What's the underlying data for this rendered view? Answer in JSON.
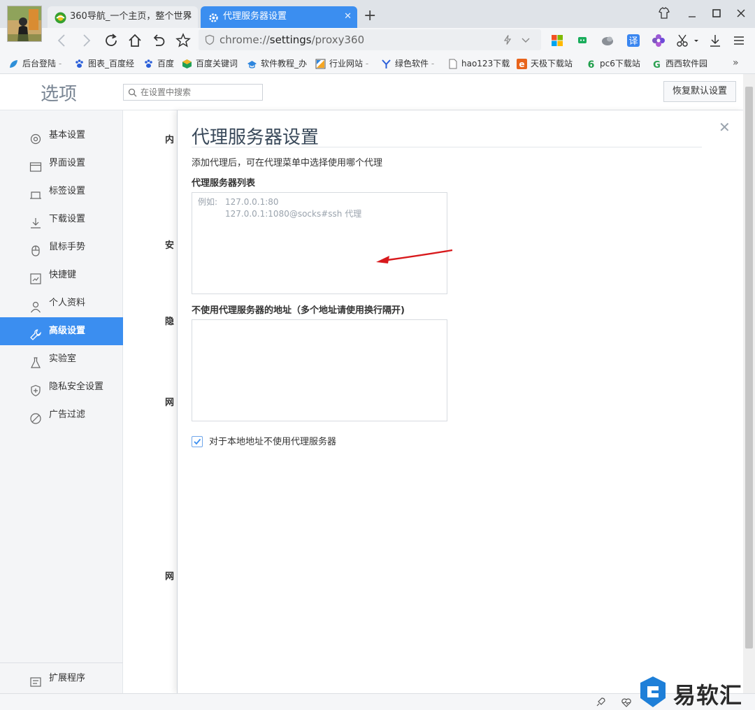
{
  "tabs": [
    {
      "title": "360导航_一个主页，整个世界",
      "active": false
    },
    {
      "title": "代理服务器设置",
      "active": true
    }
  ],
  "toolbar": {
    "url_scheme": "chrome://",
    "url_host": "settings",
    "url_path": "/proxy360"
  },
  "bookmarks": [
    {
      "label": "后台登陆",
      "icon": "leaf-icon"
    },
    {
      "label": "图表_百度经",
      "icon": "paw-icon"
    },
    {
      "label": "百度",
      "icon": "paw-icon"
    },
    {
      "label": "百度关键词",
      "icon": "cube-icon"
    },
    {
      "label": "软件教程_办",
      "icon": "hat-icon"
    },
    {
      "label": "行业网站",
      "icon": "flag-icon"
    },
    {
      "label": "绿色软件",
      "icon": "y-icon"
    },
    {
      "label": "hao123下载",
      "icon": "page-icon"
    },
    {
      "label": "天极下载站",
      "icon": "e-icon"
    },
    {
      "label": "pc6下载站",
      "icon": "six-icon"
    },
    {
      "label": "西西软件园",
      "icon": "g-icon"
    }
  ],
  "settings": {
    "title": "选项",
    "search_placeholder": "在设置中搜索",
    "restore_label": "恢复默认设置"
  },
  "nav": [
    {
      "label": "基本设置",
      "icon": "gear-icon",
      "active": false
    },
    {
      "label": "界面设置",
      "icon": "window-icon",
      "active": false
    },
    {
      "label": "标签设置",
      "icon": "tab-icon",
      "active": false
    },
    {
      "label": "下载设置",
      "icon": "download-icon",
      "active": false
    },
    {
      "label": "鼠标手势",
      "icon": "mouse-icon",
      "active": false
    },
    {
      "label": "快捷键",
      "icon": "keyboard-icon",
      "active": false
    },
    {
      "label": "个人资料",
      "icon": "person-icon",
      "active": false
    },
    {
      "label": "高级设置",
      "icon": "wrench-icon",
      "active": true
    },
    {
      "label": "实验室",
      "icon": "flask-icon",
      "active": false
    },
    {
      "label": "隐私安全设置",
      "icon": "shield-icon",
      "active": false
    },
    {
      "label": "广告过滤",
      "icon": "block-icon",
      "active": false
    }
  ],
  "nav_bottom": {
    "label": "扩展程序",
    "icon": "extension-icon"
  },
  "sections_behind": [
    "内",
    "安",
    "隐",
    "网",
    "网"
  ],
  "proxy_panel": {
    "title": "代理服务器设置",
    "description": "添加代理后，可在代理菜单中选择使用哪个代理",
    "list_label": "代理服务器列表",
    "list_example_prefix": "例如:",
    "list_example_line1": "127.0.0.1:80",
    "list_example_line2": "127.0.0.1:1080@socks#ssh 代理",
    "bypass_label": "不使用代理服务器的地址（多个地址请使用换行隔开)",
    "local_checkbox_label": "对于本地地址不使用代理服务器",
    "local_checkbox_checked": true
  },
  "watermark": "易软汇",
  "colors": {
    "accent": "#3b8ef0",
    "arrow": "#d8191c"
  }
}
